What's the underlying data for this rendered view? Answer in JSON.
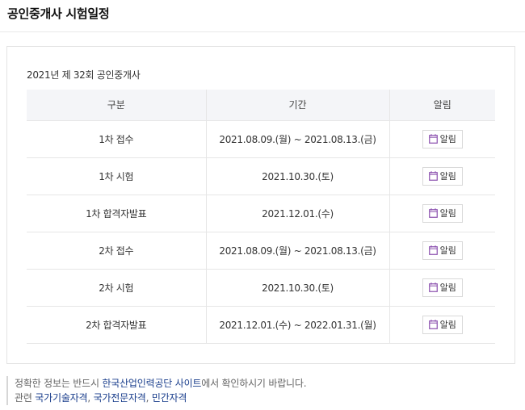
{
  "page_title": "공인중개사 시험일정",
  "caption": "2021년 제 32회 공인중개사",
  "table": {
    "headers": [
      "구분",
      "기간",
      "알림"
    ],
    "rows": [
      {
        "type": "1차 접수",
        "period": "2021.08.09.(월) ~ 2021.08.13.(금)",
        "alarm": "알림"
      },
      {
        "type": "1차 시험",
        "period": "2021.10.30.(토)",
        "alarm": "알림"
      },
      {
        "type": "1차 합격자발표",
        "period": "2021.12.01.(수)",
        "alarm": "알림"
      },
      {
        "type": "2차 접수",
        "period": "2021.08.09.(월) ~ 2021.08.13.(금)",
        "alarm": "알림"
      },
      {
        "type": "2차 시험",
        "period": "2021.10.30.(토)",
        "alarm": "알림"
      },
      {
        "type": "2차 합격자발표",
        "period": "2021.12.01.(수) ~ 2022.01.31.(월)",
        "alarm": "알림"
      }
    ]
  },
  "footer": {
    "line1_pre": "정확한 정보는 반드시 ",
    "line1_link": "한국산업인력공단 사이트",
    "line1_post": "에서 확인하시기 바랍니다.",
    "line2_pre": "관련 ",
    "links": [
      "국가기술자격",
      "국가전문자격",
      "민간자격"
    ]
  },
  "colors": {
    "link": "#1a3e8c",
    "icon": "#8a4fae",
    "header_bg": "#f4f5f8"
  },
  "icons": {
    "alarm": "calendar-icon"
  }
}
